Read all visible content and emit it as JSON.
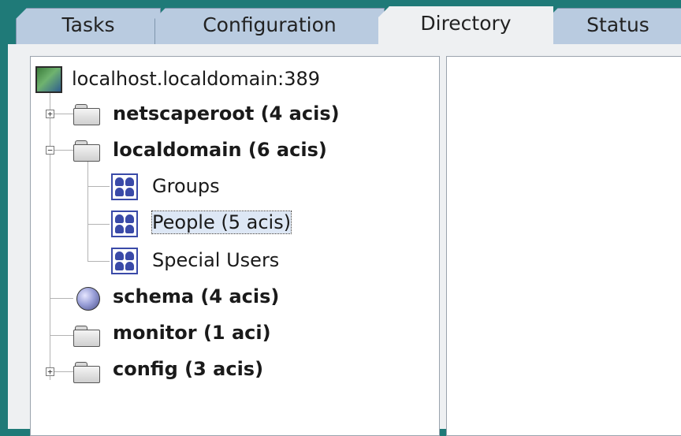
{
  "tabs": [
    {
      "label": "Tasks"
    },
    {
      "label": "Configuration"
    },
    {
      "label": "Directory"
    },
    {
      "label": "Status"
    }
  ],
  "tree": {
    "root": "localhost.localdomain:389",
    "nodes": [
      {
        "label": "netscaperoot  (4 acis)",
        "expander": "+"
      },
      {
        "label": "localdomain  (6 acis)",
        "expander": "−"
      },
      {
        "label": "Groups"
      },
      {
        "label": "People  (5 acis)"
      },
      {
        "label": "Special Users"
      },
      {
        "label": "schema  (4 acis)"
      },
      {
        "label": "monitor  (1 aci)"
      },
      {
        "label": "config  (3 acis)",
        "expander": "+"
      }
    ]
  }
}
